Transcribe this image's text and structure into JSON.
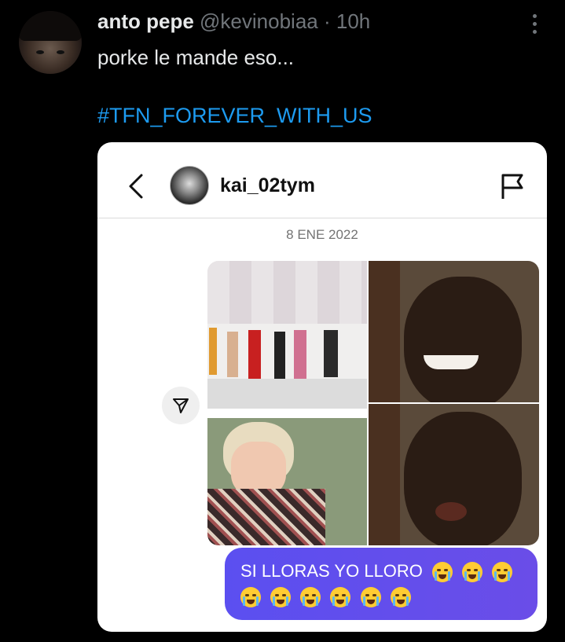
{
  "tweet": {
    "author_name": "anto pepe",
    "author_handle": "@kevinobiaa",
    "separator": "·",
    "time": "10h",
    "text": "porke le mande eso...",
    "hashtag": "#TFN_FOREVER_WITH_US"
  },
  "screenshot": {
    "username": "kai_02tym",
    "date": "8 ENE 2022",
    "message": "SI LLORAS YO LLORO",
    "emoji_count": 9,
    "message_bubble_color": "#5b4ff0"
  },
  "colors": {
    "background": "#000000",
    "text": "#e7e9ea",
    "secondary": "#71767b",
    "link": "#1d9bf0"
  }
}
